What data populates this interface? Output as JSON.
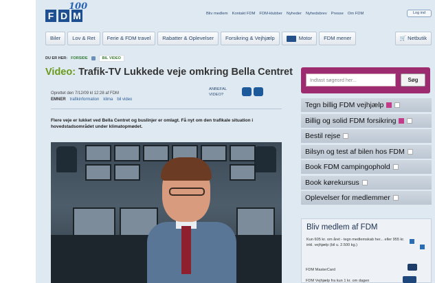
{
  "header": {
    "logo_text": [
      "F",
      "D",
      "M"
    ],
    "logo_year": "100",
    "top_links": [
      "Bliv medlem",
      "Kontakt FDM",
      "FDM-klubber",
      "Nyheder",
      "Nyhedsbrev",
      "Presse",
      "Om FDM"
    ],
    "login_label": "Log ind"
  },
  "nav": {
    "items": [
      "Biler",
      "Lov & Ret",
      "Ferie & FDM travel",
      "Rabatter & Oplevelser",
      "Forsikring & Vejhjælp",
      "Motor",
      "FDM mener"
    ],
    "netbutik_label": "Netbutik"
  },
  "breadcrumb": {
    "label": "DU ER HER:",
    "home": "FORSIDE",
    "current": "BIL VIDEO"
  },
  "article": {
    "title_prefix": "Video:",
    "title_rest": " Trafik-TV Lukkede veje omkring Bella Centret",
    "created": "Oprettet den 7/12/09 kl 12:28 af FDM",
    "tags_label": "EMNER",
    "tags": [
      "trafikinformation",
      "klima",
      "bil video"
    ],
    "recommend_line1": "ANBEFAL",
    "recommend_line2": "VIDEO?",
    "lead": "Flere veje er lukket ved Bella Centret og buslinjer er omlagt. Få nyt om den trafikale situation i hovedstadsområdet under klimatopmødet."
  },
  "search": {
    "placeholder": "Indtast søgeord her...",
    "button_label": "Søg"
  },
  "sidebar": {
    "links": [
      "Tegn billig FDM vejhjælp",
      "Billig og solid FDM forsikring",
      "Bestil rejse",
      "Bilsyn og test af bilen hos FDM",
      "Book FDM campingophold",
      "Book kørekursus",
      "Oplevelser for medlemmer"
    ]
  },
  "member": {
    "title": "Bliv medlem af FDM",
    "desc": "Kun 605 kr. om året - tegn medlemskab her... eller 955 kr. inkl. vejhjælp (bil u. 2.500 kg.)",
    "card1": "FDM MasterCard",
    "card2": "FDM Vejhjælp fra kun 1 kr. om dagen"
  }
}
